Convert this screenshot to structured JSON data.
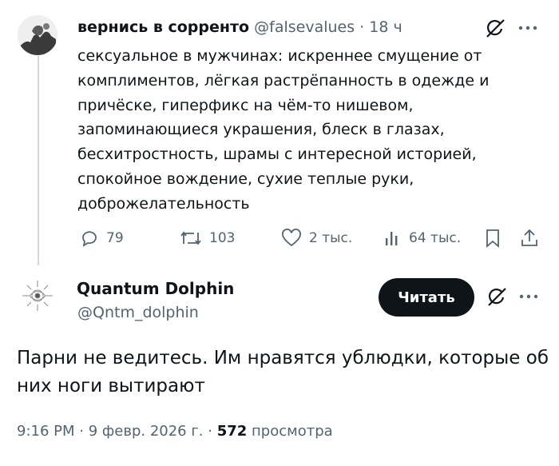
{
  "tweet1": {
    "display_name": "вернись в сорренто",
    "handle": "@falsevalues",
    "separator": " · ",
    "time": "18 ч",
    "text_lines": [
      "сексуальное в мужчинах: искреннее смущение от",
      "комплиментов, лёгкая растрёпанность в одежде и",
      "причёске, гиперфикс на чём-то нишевом,",
      "запоминающиеся украшения, блеск в глазах,",
      "бесхитростность, шрамы с интересной историей,",
      "спокойное вождение, сухие теплые руки,",
      "доброжелательность"
    ],
    "replies": "79",
    "retweets": "103",
    "likes": "2 тыс.",
    "views": "64 тыс."
  },
  "tweet2": {
    "display_name": "Quantum Dolphin",
    "handle": "@Qntm_dolphin",
    "follow_label": "Читать",
    "text_lines": [
      "Парни не ведитесь. Им нравятся ублюдки, которые об",
      "них ноги вытирают"
    ],
    "time": "9:16 PM",
    "date": "9 февр. 2026 г.",
    "views_count": "572",
    "views_label": "просмотра",
    "meta_sep": " · "
  },
  "icons": [
    "grok-icon",
    "more-icon",
    "reply-icon",
    "retweet-icon",
    "like-icon",
    "views-icon",
    "bookmark-icon",
    "share-icon"
  ],
  "colors": {
    "text": "#0f1419",
    "muted": "#536471",
    "thread_line": "#cfd9de",
    "button_bg": "#0f1419"
  }
}
